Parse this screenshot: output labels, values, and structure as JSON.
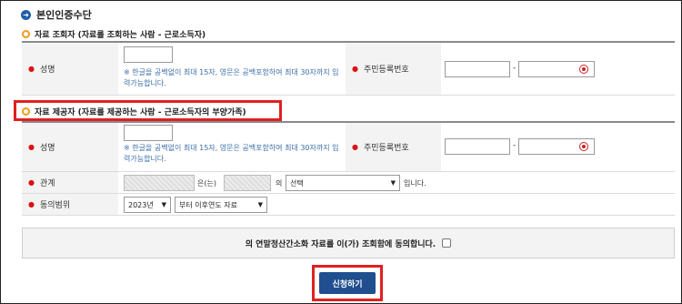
{
  "title": {
    "icon": "circle-arrow-icon",
    "text": "본인인증수단"
  },
  "inquirer": {
    "heading": "자료 조회자 (자료를 조회하는 사람 - 근로소득자)",
    "name_label": "성명",
    "name_note": "※ 한글을 공백없이 최대 15자, 영문은 공백포함하여 최대 30자까지 입력가능합니다.",
    "rrn_label": "주민등록번호",
    "rrn_dash": "-"
  },
  "provider": {
    "heading": "자료 제공자 (자료를 제공하는 사람 - 근로소득자의 부양가족)",
    "name_label": "성명",
    "name_note": "※ 한글을 공백없이 최대 15자, 영문은 공백포함하여 최대 30자까지 입력가능합니다.",
    "rrn_label": "주민등록번호",
    "rrn_dash": "-",
    "relation_label": "관계",
    "relation_text1": "은(는)",
    "relation_text2": "의",
    "relation_select": "선택",
    "relation_text3": "입니다.",
    "scope_label": "동의범위",
    "scope_year": "2023년",
    "scope_option": "부터 이후연도 자료"
  },
  "agreement": {
    "text": "의 연말정산간소화 자료를 이(가) 조회함에 동의합니다."
  },
  "submit": {
    "label": "신청하기"
  },
  "colors": {
    "accent": "#1f4f8f",
    "highlight": "#e02020",
    "ring": "#f39a1e",
    "note": "#3b6ea8"
  }
}
